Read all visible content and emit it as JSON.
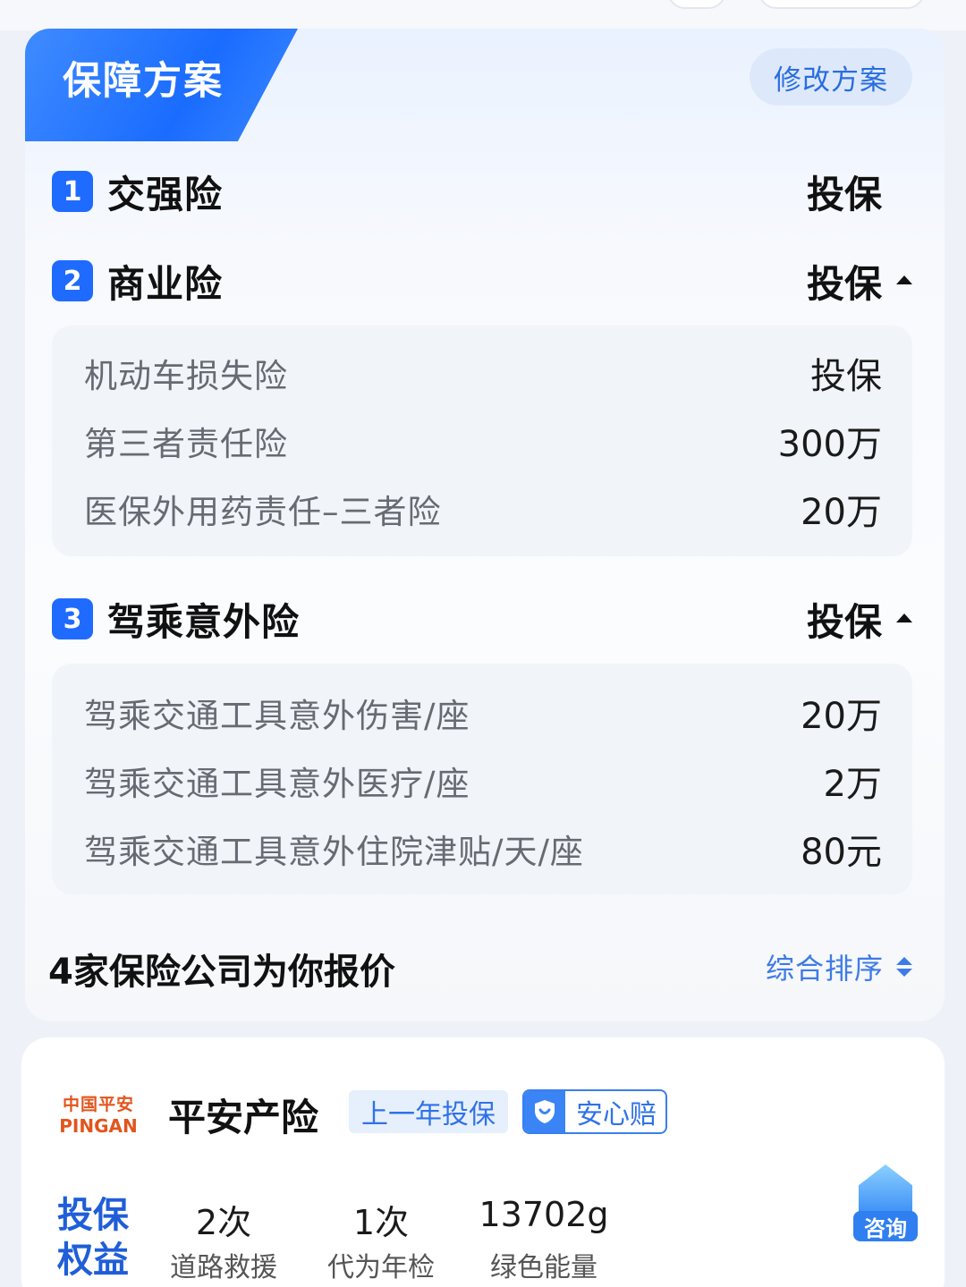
{
  "plan": {
    "title": "保障方案",
    "modify_label": "修改方案",
    "sections": [
      {
        "num": "1",
        "title": "交强险",
        "value": "投保",
        "expanded": false,
        "items": []
      },
      {
        "num": "2",
        "title": "商业险",
        "value": "投保",
        "expanded": true,
        "items": [
          {
            "label": "机动车损失险",
            "value": "投保"
          },
          {
            "label": "第三者责任险",
            "value": "300万"
          },
          {
            "label": "医保外用药责任–三者险",
            "value": "20万"
          }
        ]
      },
      {
        "num": "3",
        "title": "驾乘意外险",
        "value": "投保",
        "expanded": true,
        "items": [
          {
            "label": "驾乘交通工具意外伤害/座",
            "value": "20万"
          },
          {
            "label": "驾乘交通工具意外医疗/座",
            "value": "2万"
          },
          {
            "label": "驾乘交通工具意外住院津贴/天/座",
            "value": "80元"
          }
        ]
      }
    ]
  },
  "quotes": {
    "title": "4家保险公司为你报价",
    "sort_label": "综合排序"
  },
  "company": {
    "logo_cn": "中国平安",
    "logo_en": "PINGAN",
    "name": "平安产险",
    "tag_last_year": "上一年投保",
    "tag_worry_free": "安心赔",
    "benefit_label": "投保权益",
    "benefits": [
      {
        "value": "2次",
        "label": "道路救援"
      },
      {
        "value": "1次",
        "label": "代为年检"
      },
      {
        "value": "13702g",
        "label": "绿色能量"
      }
    ],
    "consult_label": "咨询"
  },
  "colors": {
    "accent": "#1f6bff",
    "logo_orange": "#e2551c"
  }
}
